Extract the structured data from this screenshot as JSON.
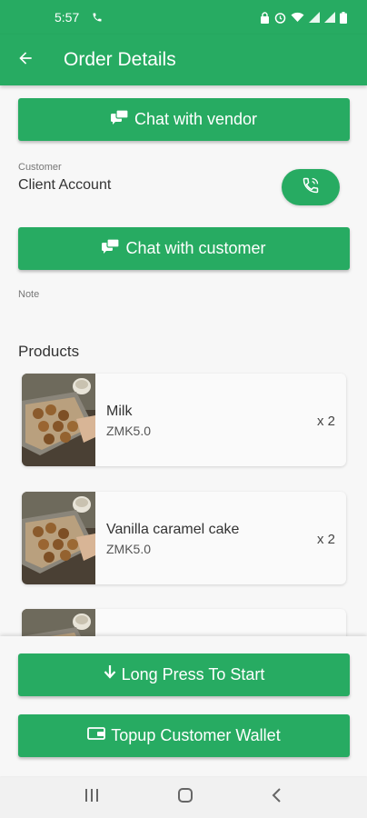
{
  "status_bar": {
    "time": "5:57"
  },
  "app_bar": {
    "title": "Order Details"
  },
  "buttons": {
    "chat_vendor": "Chat with vendor",
    "chat_customer": "Chat with customer",
    "long_press": "Long Press To Start",
    "topup": "Topup Customer Wallet"
  },
  "customer": {
    "label": "Customer",
    "name": "Client Account"
  },
  "note": {
    "label": "Note",
    "value": ""
  },
  "products": {
    "title": "Products",
    "items": [
      {
        "name": "Milk",
        "price": "ZMK5.0",
        "qty": "x 2"
      },
      {
        "name": "Vanilla caramel cake",
        "price": "ZMK5.0",
        "qty": "x 2"
      },
      {
        "name": "",
        "price": "",
        "qty": ""
      }
    ]
  },
  "colors": {
    "primary": "#27ab62",
    "background": "#f7f7f7"
  }
}
